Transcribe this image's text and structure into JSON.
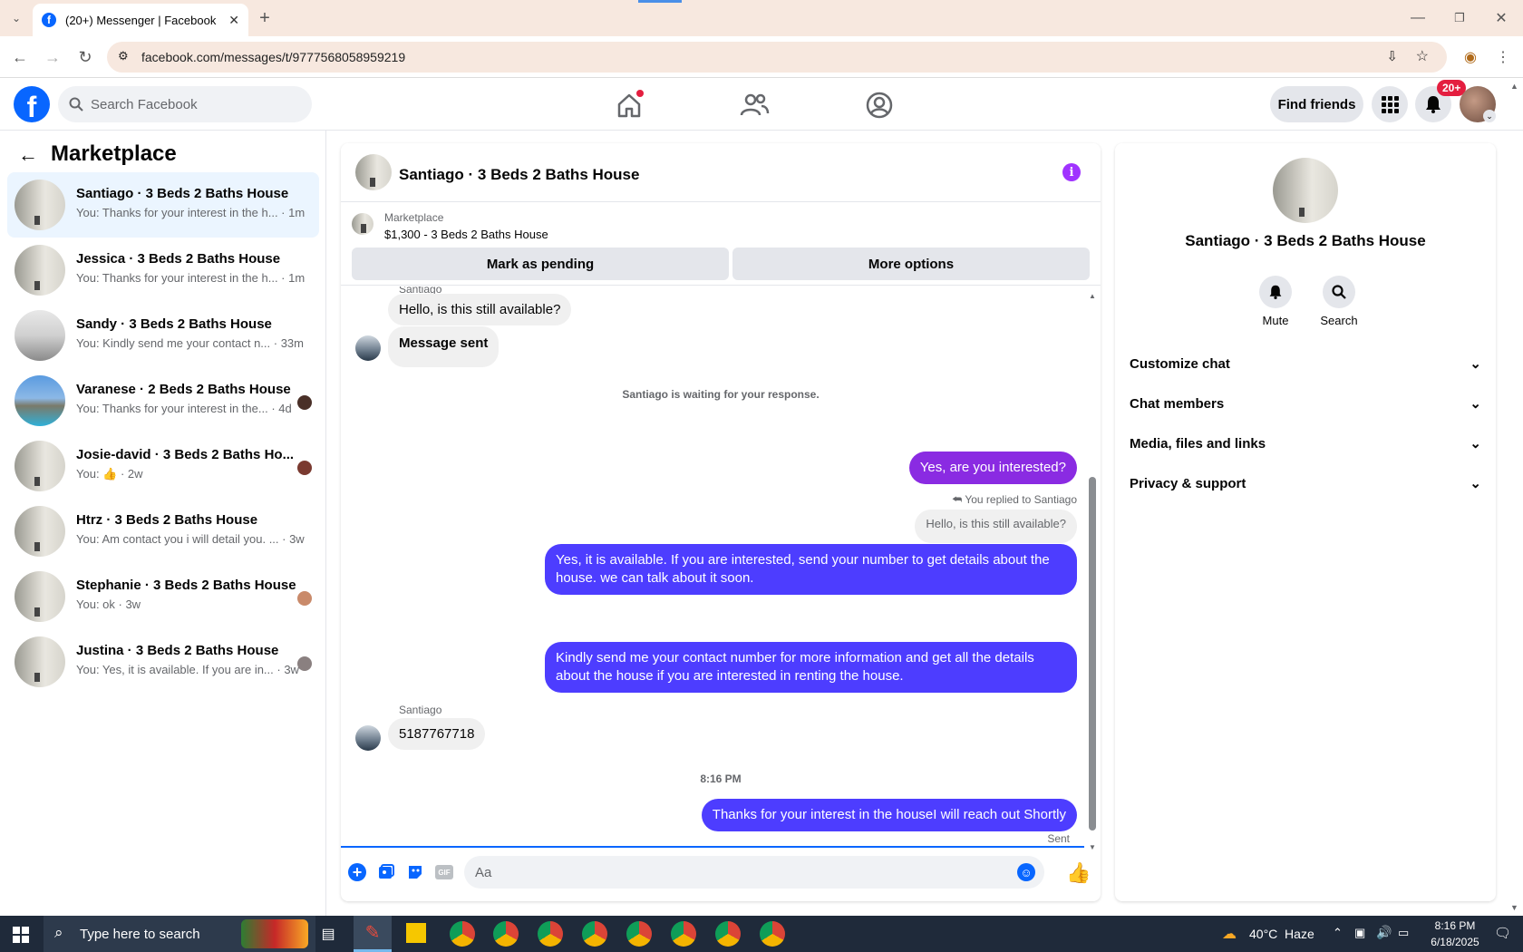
{
  "browser": {
    "tab_title": "(20+) Messenger | Facebook",
    "url": "facebook.com/messages/t/9777568058959219"
  },
  "header": {
    "search_placeholder": "Search Facebook",
    "find_friends": "Find friends",
    "notif_badge": "20+"
  },
  "left": {
    "title": "Marketplace",
    "conversations": [
      {
        "title": "Santiago · 3 Beds 2 Baths House",
        "sub": "You: Thanks for your interest in the h... · 1m"
      },
      {
        "title": "Jessica · 3 Beds 2 Baths House",
        "sub": "You: Thanks for your interest in the h... · 1m"
      },
      {
        "title": "Sandy · 3 Beds 2 Baths House",
        "sub": "You: Kindly send me your contact n... · 33m"
      },
      {
        "title": "Varanese · 2 Beds 2 Baths House",
        "sub": "You: Thanks for your interest in the... · 4d"
      },
      {
        "title": "Josie-david · 3 Beds 2 Baths Ho...",
        "sub": "You: 👍 · 2w"
      },
      {
        "title": "Htrz · 3 Beds 2 Baths House",
        "sub": "You: Am contact you i will detail you. ... · 3w"
      },
      {
        "title": "Stephanie · 3 Beds 2 Baths House",
        "sub": "You: ok · 3w"
      },
      {
        "title": "Justina · 3 Beds 2 Baths House",
        "sub": "You: Yes, it is available. If you are in... · 3w"
      }
    ]
  },
  "chat": {
    "title": "Santiago · 3 Beds 2 Baths House",
    "listing_source": "Marketplace",
    "listing_title": "$1,300 - 3 Beds 2 Baths House",
    "mark_pending": "Mark as pending",
    "more_options": "More options",
    "sender_top": "Santiago",
    "msg1": "Hello, is this still available?",
    "msg2": "Message sent",
    "waiting": "Santiago is waiting for your response.",
    "msg3": "Yes, are you interested?",
    "replied": "You replied to Santiago",
    "quoted": "Hello, is this still available?",
    "msg4": "Yes, it is available. If you are interested, send your number to get details about the house. we can talk about it soon.",
    "msg5": "Kindly send me your contact number for more information and get all the details about the house if you are interested in renting the house.",
    "sender2": "Santiago",
    "msg6": "5187767718",
    "time": "8:16 PM",
    "msg7": "Thanks for your interest in the houseI will reach out Shortly",
    "sent": "Sent",
    "composer_placeholder": "Aa"
  },
  "info": {
    "name": "Santiago · 3 Beds 2 Baths House",
    "mute": "Mute",
    "search": "Search",
    "sections": [
      "Customize chat",
      "Chat members",
      "Media, files and links",
      "Privacy & support"
    ]
  },
  "taskbar": {
    "search_placeholder": "Type here to search",
    "weather": "40°C  Haze",
    "time": "8:16 PM",
    "date": "6/18/2025"
  },
  "colors": {
    "fb_blue": "#0866ff",
    "bubble_blue": "#4d3dff",
    "accent_purple": "#a033ff",
    "selected_bg": "#ebf5ff"
  }
}
